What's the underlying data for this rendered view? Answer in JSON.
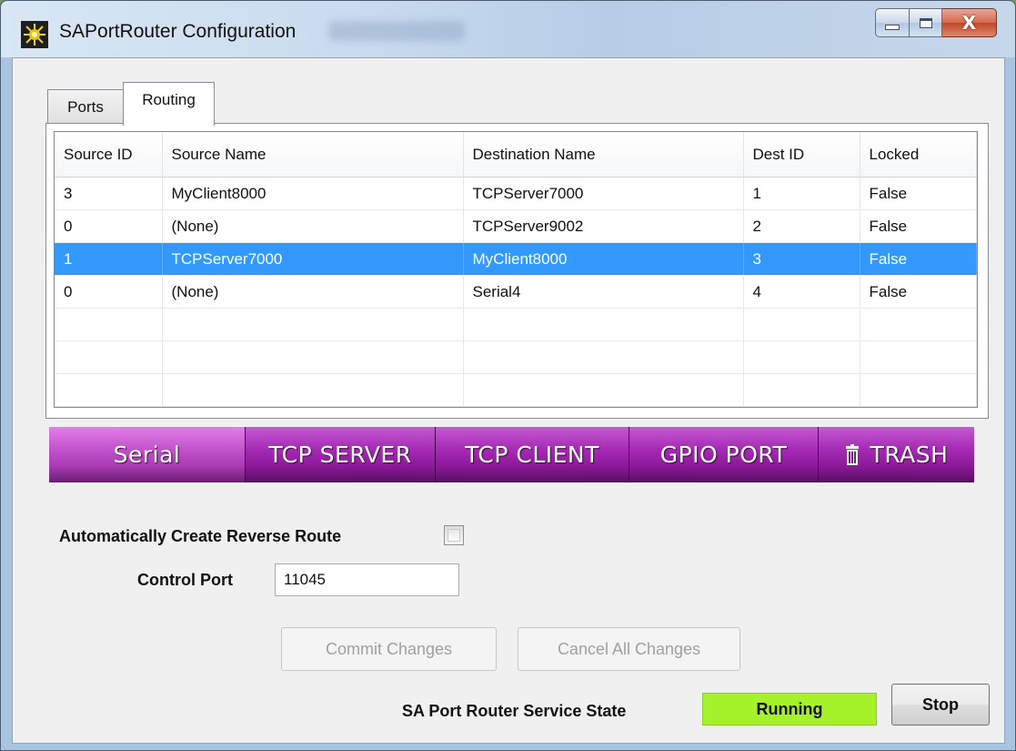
{
  "window": {
    "title": "SAPortRouter Configuration",
    "close_glyph": "X"
  },
  "tabs": [
    {
      "label": "Ports",
      "active": false
    },
    {
      "label": "Routing",
      "active": true
    }
  ],
  "routes_table": {
    "columns": [
      "Source ID",
      "Source Name",
      "Destination Name",
      "Dest ID",
      "Locked"
    ],
    "rows": [
      {
        "source_id": "3",
        "source_name": "MyClient8000",
        "destination_name": "TCPServer7000",
        "dest_id": "1",
        "locked": "False",
        "selected": false
      },
      {
        "source_id": "0",
        "source_name": "(None)",
        "destination_name": "TCPServer9002",
        "dest_id": "2",
        "locked": "False",
        "selected": false
      },
      {
        "source_id": "1",
        "source_name": "TCPServer7000",
        "destination_name": "MyClient8000",
        "dest_id": "3",
        "locked": "False",
        "selected": true
      },
      {
        "source_id": "0",
        "source_name": "(None)",
        "destination_name": "Serial4",
        "dest_id": "4",
        "locked": "False",
        "selected": false
      }
    ],
    "selection_color": "#3399ff"
  },
  "palette": {
    "serial": "Serial",
    "tcp_server": "TCP SERVER",
    "tcp_client": "TCP CLIENT",
    "gpio_port": "GPIO PORT",
    "trash": "TRASH",
    "trash_icon": "trash-can-icon",
    "accent": "#a62ab6"
  },
  "settings": {
    "reverse_route_label": "Automatically Create Reverse Route",
    "reverse_route_checked": false,
    "control_port_label": "Control Port",
    "control_port_value": "11045"
  },
  "actions": {
    "commit": "Commit Changes",
    "cancel": "Cancel All Changes",
    "enabled": false
  },
  "service": {
    "label": "SA Port Router Service State",
    "state": "Running",
    "state_color": "#a6f22a",
    "stop_label": "Stop"
  }
}
